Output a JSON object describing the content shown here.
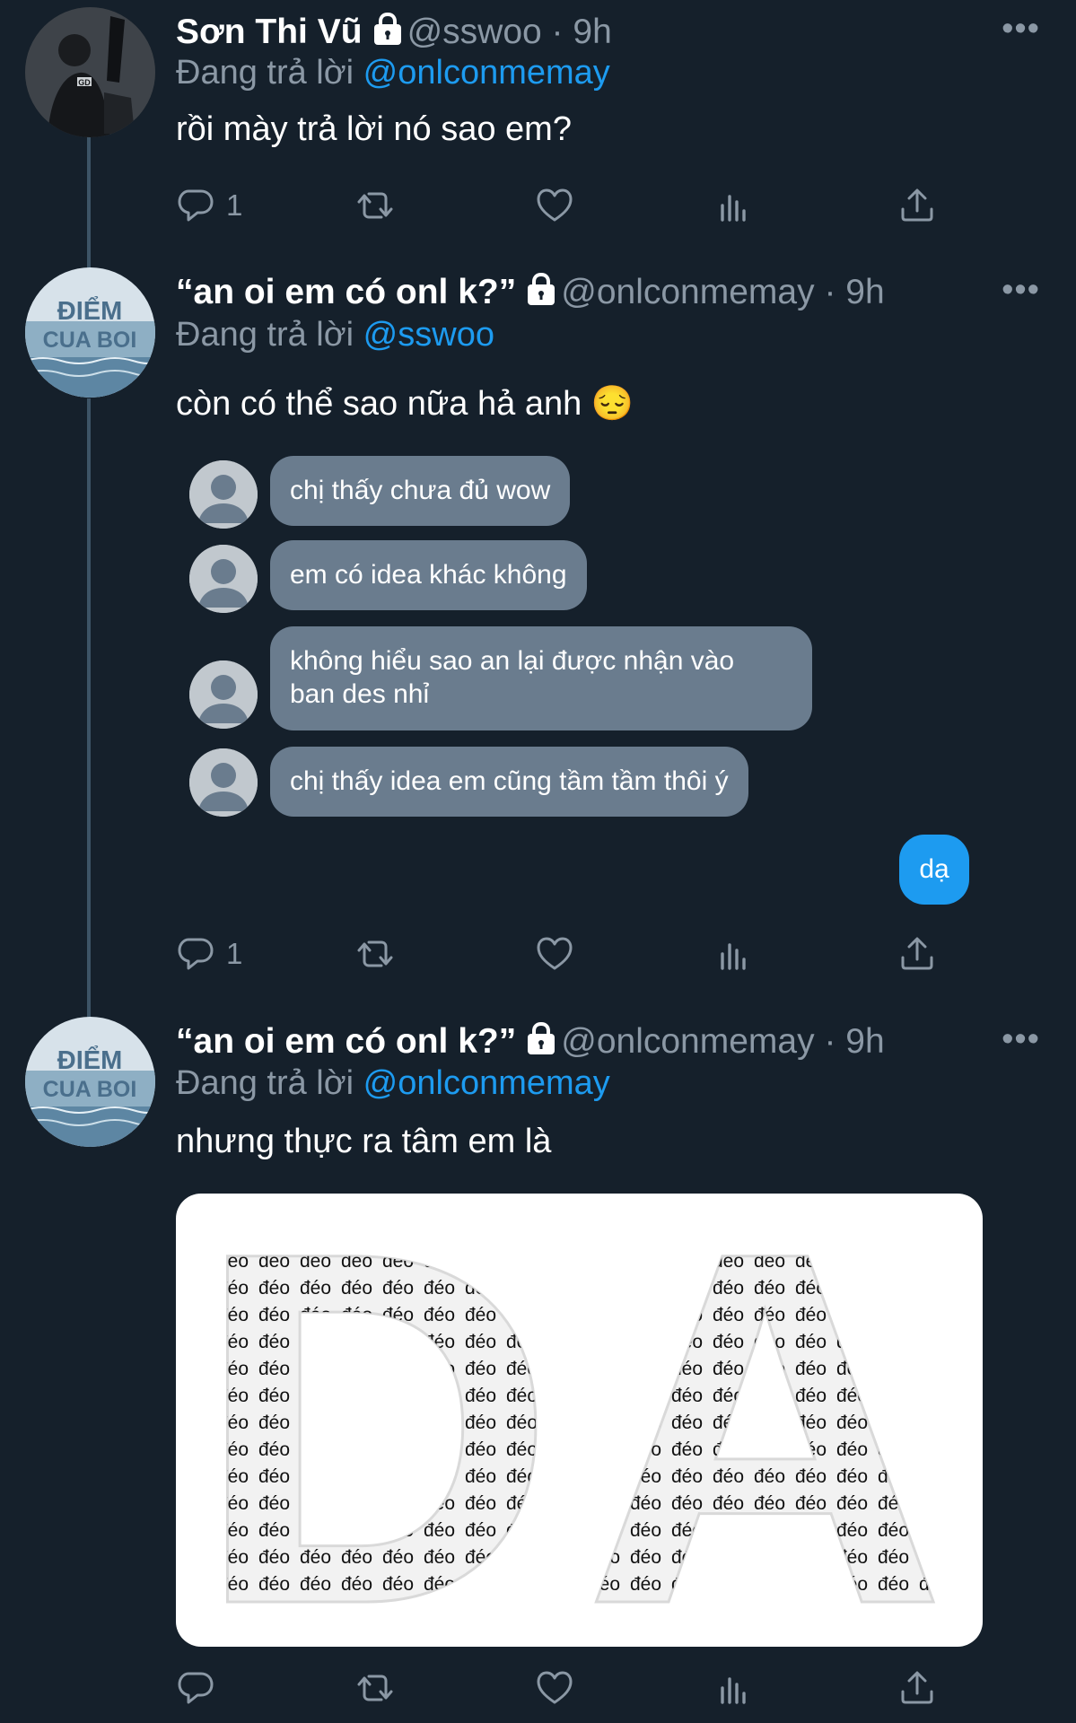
{
  "tweets": [
    {
      "name": "Sơn Thi Vũ",
      "handle": "@sswoo",
      "time": "9h",
      "reply_label": "Đang trả lời",
      "reply_to": "@onlconmemay",
      "text": "rồi mày trả lời nó sao em?",
      "reply_count": "1"
    },
    {
      "name": "“an oi em có onl k?”",
      "handle": "@onlconmemay",
      "time": "9h",
      "reply_label": "Đang trả lời",
      "reply_to": "@sswoo",
      "text": "còn có thể sao nữa hả anh 😔",
      "reply_count": "1",
      "chat": [
        "chị thấy chưa đủ wow",
        "em có idea khác không",
        "không hiểu sao an lại được nhận vào",
        "ban des nhỉ",
        "chị thấy idea em cũng tầm tầm thôi ý"
      ],
      "chat_reply": "dạ"
    },
    {
      "name": "“an oi em có onl k?”",
      "handle": "@onlconmemay",
      "time": "9h",
      "reply_label": "Đang trả lời",
      "reply_to": "@onlconmemay",
      "text": "nhưng thực ra tâm em là",
      "media_word": "đéo",
      "media_letters": "DA"
    }
  ],
  "separator": "·",
  "more_glyph": "•••",
  "avatar_art": {
    "album_title_1": "ĐIỂM",
    "album_title_2": "CUA BOI",
    "tile_label": "GD"
  },
  "colors": {
    "background": "#15202b",
    "accent": "#1d9bf0",
    "secondary_text": "#8b98a5",
    "bubble": "#6a7c8e",
    "thread_line": "#3d5466"
  },
  "icons": [
    "lock-icon",
    "reply-icon",
    "retweet-icon",
    "like-icon",
    "analytics-icon",
    "share-icon",
    "more-icon",
    "person-icon"
  ]
}
